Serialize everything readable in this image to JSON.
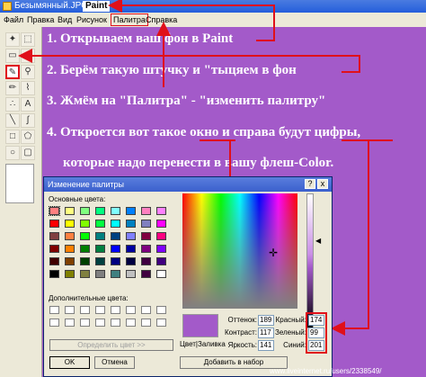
{
  "paint": {
    "filename": "Безымянный.JPG",
    "app_name": "Paint",
    "menu": [
      "Файл",
      "Правка",
      "Вид",
      "Рисунок",
      "Палитра",
      "Справка"
    ]
  },
  "annotations": [
    "1. Открываем ваш фон в Paint",
    "2. Берём такую штучку и \"тыцяем в фон",
    "3.  Жмём на \"Палитра\"  - \"изменить палитру\"",
    "4. Откроется вот такое окно и справа будут цифры,",
    "которые надо перенести в вашу флеш-Color."
  ],
  "dialog": {
    "title": "Изменение палитры",
    "basic_colors_label": "Основные цвета:",
    "custom_colors_label": "Дополнительные цвета:",
    "define_button": "Определить цвет >>",
    "ok_button": "OK",
    "cancel_button": "Отмена",
    "color_solid_label": "Цвет|Заливка",
    "add_button": "Добавить в набор",
    "hue_label": "Оттенок:",
    "hue": "189",
    "sat_label": "Контраст:",
    "sat": "117",
    "lum_label": "Яркость:",
    "lum": "141",
    "red_label": "Красный:",
    "red": "174",
    "green_label": "Зеленый:",
    "green": "99",
    "blue_label": "Синий:",
    "blue": "201",
    "help_icon": "?",
    "close_icon": "x"
  },
  "watermark": "www.liveinternet.ru/users/2338549/",
  "colors": {
    "background": "#a35ac9",
    "annotation_red": "#e0101a",
    "basic": [
      "#ff8080",
      "#ffff80",
      "#80ff80",
      "#00ff80",
      "#80ffff",
      "#0080ff",
      "#ff80c0",
      "#ff80ff",
      "#ff0000",
      "#ffff00",
      "#80ff00",
      "#00ff40",
      "#00ffff",
      "#0080c0",
      "#8080c0",
      "#ff00ff",
      "#804040",
      "#ff8040",
      "#00ff00",
      "#008080",
      "#004080",
      "#8080ff",
      "#800040",
      "#ff0080",
      "#800000",
      "#ff8000",
      "#008000",
      "#008040",
      "#0000ff",
      "#0000a0",
      "#800080",
      "#8000ff",
      "#400000",
      "#804000",
      "#004000",
      "#004040",
      "#000080",
      "#000040",
      "#400040",
      "#400080",
      "#000000",
      "#808000",
      "#808040",
      "#808080",
      "#408080",
      "#c0c0c0",
      "#400040",
      "#ffffff"
    ]
  }
}
